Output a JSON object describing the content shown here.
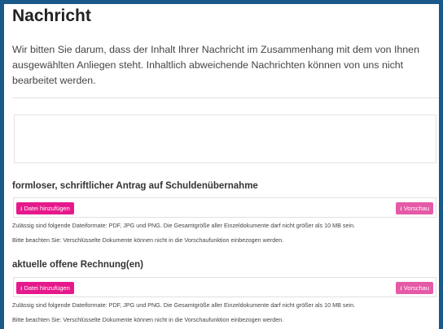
{
  "page": {
    "title": "Nachricht",
    "intro": "Wir bitten Sie darum, dass der Inhalt Ihrer Nachricht im Zusammenhang mit dem von Ihnen ausgewählten Anliegen steht. Inhaltlich abweichende Nachrichten können von uns nicht bearbeitet werden."
  },
  "message": {
    "value": ""
  },
  "uploads": [
    {
      "heading": "formloser, schriftlicher Antrag auf Schuldenübernahme",
      "add_label": "Datei hinzufügen",
      "preview_label": "Vorschau",
      "hint_formats": "Zulässig sind folgende Dateiformate: PDF, JPG und PNG. Die Gesamtgröße aller Einzeldokumente darf nicht größer als 10 MB sein.",
      "hint_encrypted": "Bitte beachten Sie: Verschlüsselte Dokumente können nicht in die Vorschaufunktion einbezogen werden."
    },
    {
      "heading": "aktuelle offene Rechnung(en)",
      "add_label": "Datei hinzufügen",
      "preview_label": "Vorschau",
      "hint_formats": "Zulässig sind folgende Dateiformate: PDF, JPG und PNG. Die Gesamtgröße aller Einzeldokumente darf nicht größer als 10 MB sein.",
      "hint_encrypted": "Bitte beachten Sie: Verschlüsselte Dokumente können nicht in die Vorschaufunktion einbezogen werden."
    }
  ],
  "icons": {
    "upload": "upload-icon"
  },
  "colors": {
    "accent": "#e6198c",
    "accent_light": "#e55aa6",
    "frame": "#1a5a8a"
  }
}
